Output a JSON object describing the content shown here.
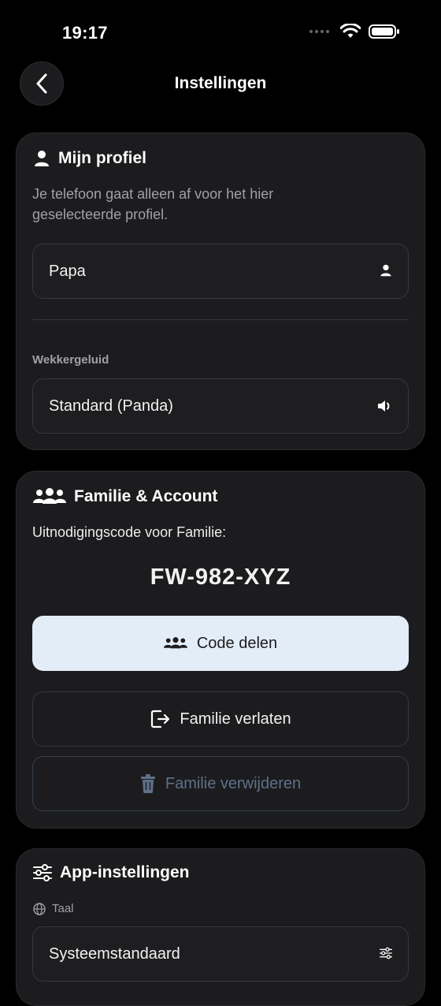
{
  "status_bar": {
    "time": "19:17"
  },
  "nav": {
    "title": "Instellingen"
  },
  "profile": {
    "title": "Mijn profiel",
    "description": "Je telefoon gaat alleen af voor het hier geselecteerde profiel.",
    "selected_profile": "Papa",
    "alarm_sound_label": "Wekkergeluid",
    "alarm_sound_value": "Standard (Panda)"
  },
  "family": {
    "title": "Familie & Account",
    "invite_label": "Uitnodigingscode voor Familie:",
    "invite_code": "FW-982-XYZ",
    "share_button": "Code delen",
    "leave_button": "Familie verlaten",
    "delete_button": "Familie verwijderen"
  },
  "app_settings": {
    "title": "App-instellingen",
    "language_label": "Taal",
    "language_value": "Systeemstandaard"
  },
  "colors": {
    "background": "#000000",
    "card": "#1c1c1e",
    "share_button_bg": "#e3edf7",
    "delete_text": "#5e7189"
  }
}
